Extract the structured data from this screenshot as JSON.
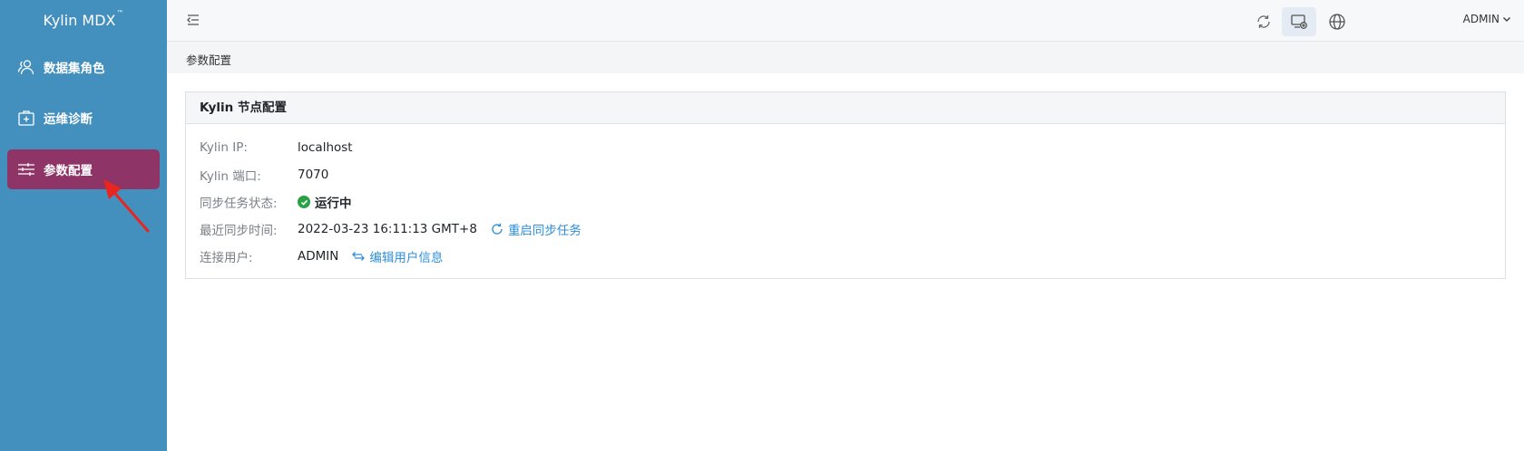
{
  "app": {
    "title": "Kylin MDX",
    "title_mark": "™"
  },
  "sidebar": {
    "items": [
      {
        "label": "数据集角色",
        "icon": "user-group-icon",
        "active": false
      },
      {
        "label": "运维诊断",
        "icon": "medical-kit-icon",
        "active": false
      },
      {
        "label": "参数配置",
        "icon": "sliders-icon",
        "active": true
      }
    ]
  },
  "header": {
    "icons": [
      "refresh-icon",
      "monitor-settings-icon",
      "globe-icon"
    ],
    "user": "ADMIN"
  },
  "breadcrumb": "参数配置",
  "card": {
    "title": "Kylin 节点配置",
    "rows": [
      {
        "label": "Kylin IP:",
        "value": "localhost"
      },
      {
        "label": "Kylin 端口:",
        "value": "7070"
      },
      {
        "label": "同步任务状态:",
        "value": "运行中"
      },
      {
        "label": "最近同步时间:",
        "value": "2022-03-23 16:11:13 GMT+8",
        "action": "重启同步任务"
      },
      {
        "label": "连接用户:",
        "value": "ADMIN",
        "action": "编辑用户信息"
      }
    ]
  },
  "colors": {
    "sidebar": "#438fbd",
    "active_item": "#8e3466",
    "link": "#2f8fd8",
    "status_ok": "#2ba146",
    "annotation_arrow": "#e8251f"
  }
}
